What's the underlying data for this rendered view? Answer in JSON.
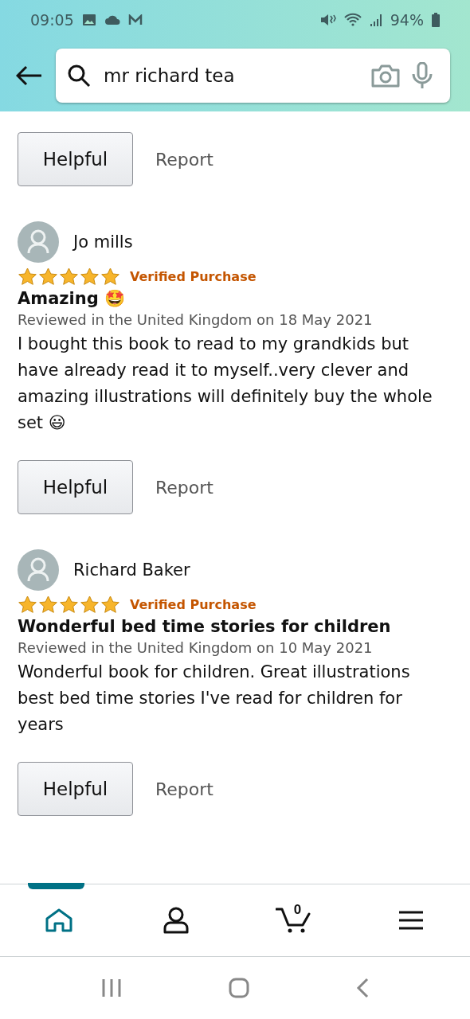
{
  "status_bar": {
    "time": "09:05",
    "battery": "94%"
  },
  "search": {
    "value": "mr richard tea"
  },
  "top_actions": {
    "helpful": "Helpful",
    "report": "Report"
  },
  "reviews": [
    {
      "author": "Jo mills",
      "stars": 5,
      "badge": "Verified Purchase",
      "title": "Amazing 🤩",
      "meta": "Reviewed in the United Kingdom on 18 May 2021",
      "body": "I bought this book to read to my grandkids but have already read it to myself..very clever and amazing illustrations will definitely buy the whole set 😃",
      "helpful": "Helpful",
      "report": "Report"
    },
    {
      "author": "Richard Baker",
      "stars": 5,
      "badge": "Verified Purchase",
      "title": "Wonderful bed time stories for children",
      "meta": "Reviewed in the United Kingdom on 10 May 2021",
      "body": "Wonderful book for children. Great illustrations best bed time stories I've read for children for years",
      "helpful": "Helpful",
      "report": "Report"
    }
  ],
  "bottom_nav": [
    {
      "kind": "home",
      "selected": true
    },
    {
      "kind": "account",
      "selected": false
    },
    {
      "kind": "cart",
      "selected": false,
      "count": "0"
    },
    {
      "kind": "menu",
      "selected": false
    }
  ]
}
